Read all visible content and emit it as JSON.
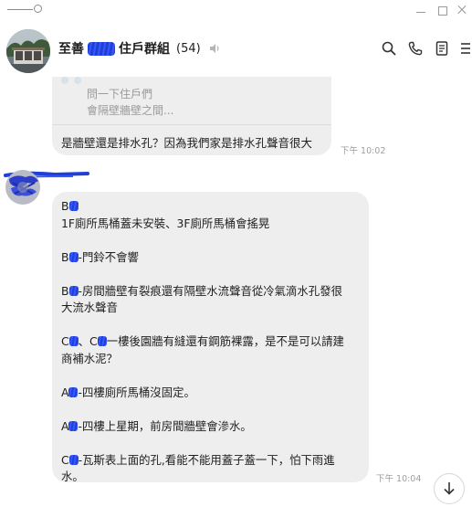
{
  "window": {
    "pin_icon": "pin-icon",
    "minimize_icon": "minimize-icon",
    "maximize_icon": "maximize-icon",
    "close_icon": "close-icon"
  },
  "header": {
    "title_prefix": "至善",
    "title_suffix": "住戶群組",
    "member_count": "(54)",
    "icons": [
      "search-icon",
      "phone-icon",
      "notes-icon",
      "more-icon"
    ],
    "speaker_icon": "speaker-icon"
  },
  "messages": [
    {
      "reply": {
        "author": "",
        "lines": [
          "問一下住戶們",
          "會隔壁牆壁之間..."
        ]
      },
      "text": "是牆壁還是排水孔？因為我們家是排水孔聲音很大",
      "time": "下午 10:02"
    },
    {
      "lines": [
        "B",
        "1F廁所馬桶蓋未安裝、3F廁所馬桶會搖晃",
        "",
        "B-門鈴不會響",
        "",
        "B-房間牆壁有裂痕還有隔壁水流聲音從冷氣滴水孔發很",
        "大流水聲音",
        "",
        "C、C一樓後園牆有縫還有鋼筋裸露，是不是可以請建",
        "商補水泥？",
        "",
        "A-四樓廁所馬桶沒固定。",
        "",
        "A-四樓上星期，前房間牆壁會滲水。",
        "",
        "C-瓦斯表上面的孔,看能不能用蓋子蓋一下，怕下雨進",
        "水。"
      ],
      "time": "下午 10:04"
    }
  ],
  "scroll_button": {
    "icon": "arrow-down-icon"
  },
  "colors": {
    "bubble": "#eeeeee",
    "redaction": "#2a4bf0",
    "time": "#9e9e9e"
  }
}
